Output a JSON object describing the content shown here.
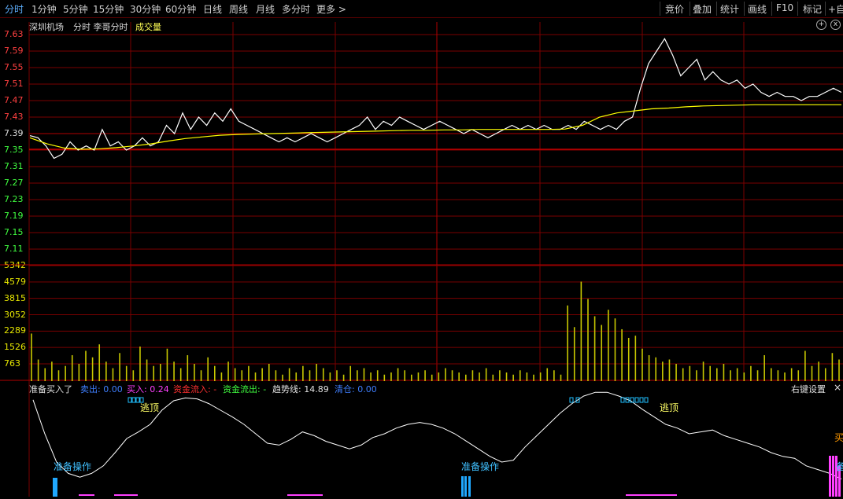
{
  "toolbar": {
    "periods": [
      "分时",
      "1分钟",
      "5分钟",
      "15分钟",
      "30分钟",
      "60分钟",
      "日线",
      "周线",
      "月线",
      "多分时",
      "更多"
    ],
    "more_glyph": ">",
    "right_buttons": [
      "竞价",
      "叠加",
      "统计",
      "画线",
      "F10",
      "标记",
      "+自"
    ]
  },
  "chart_header": {
    "stock": "深圳机场",
    "view": "分时 李哥分时",
    "indicator": "成交量",
    "controls": [
      "+",
      "x"
    ]
  },
  "indicator_bar": {
    "name": "准备买入了",
    "items": [
      {
        "label": "卖出:",
        "value": "0.00",
        "color": "#3f7fff"
      },
      {
        "label": "买入:",
        "value": "0.24",
        "color": "#ff40ff"
      },
      {
        "label": "资金流入:",
        "value": "-",
        "color": "#ff3030"
      },
      {
        "label": "资金流出:",
        "value": "-",
        "color": "#40ff40"
      },
      {
        "label": "趋势线:",
        "value": "14.89",
        "color": "#e0e0e0"
      },
      {
        "label": "清仓:",
        "value": "0.00",
        "color": "#3f7fff"
      }
    ],
    "right_settings": "右键设置",
    "close_glyph": "×"
  },
  "price_axis": [
    "7.63",
    "7.59",
    "7.55",
    "7.51",
    "7.47",
    "7.43",
    "7.39",
    "7.35",
    "7.31",
    "7.27",
    "7.23",
    "7.19",
    "7.15",
    "7.11"
  ],
  "volume_axis": [
    "5342",
    "4579",
    "3815",
    "3052",
    "2289",
    "1526",
    "763"
  ],
  "signal_labels": [
    {
      "text": "逃顶",
      "color": "#ffff66"
    },
    {
      "text": "准备操作",
      "color": "#40c0ff"
    },
    {
      "text": "准备操作",
      "color": "#40c0ff"
    },
    {
      "text": "逃顶",
      "color": "#ffff66"
    },
    {
      "text": "买",
      "color": "#ff9900"
    },
    {
      "text": "备",
      "color": "#40c0ff"
    }
  ],
  "colors": {
    "grid": "#7a0000",
    "price_line": "#ffffff",
    "avg_line": "#ffff00",
    "volume": "#c8c800",
    "up_axis": "#ff4040",
    "down_axis": "#40ff40",
    "vol_axis": "#e6e600"
  },
  "chart_data": [
    {
      "type": "line",
      "title": "",
      "series": [
        {
          "name": "",
          "values": [
            7.385,
            7.38,
            7.36,
            7.33,
            7.34,
            7.37,
            7.35,
            7.36,
            7.35,
            7.4,
            7.36,
            7.37,
            7.35,
            7.36,
            7.38,
            7.36,
            7.37,
            7.41,
            7.39,
            7.44,
            7.4,
            7.43,
            7.41,
            7.44,
            7.42,
            7.45,
            7.42,
            7.41,
            7.4,
            7.39,
            7.38,
            7.37,
            7.38,
            7.37,
            7.38,
            7.39,
            7.38,
            7.37,
            7.38,
            7.39,
            7.4,
            7.41,
            7.43,
            7.4,
            7.42,
            7.41,
            7.43,
            7.42,
            7.41,
            7.4,
            7.41,
            7.42,
            7.41,
            7.4,
            7.39,
            7.4,
            7.39,
            7.38,
            7.39,
            7.4,
            7.41,
            7.4,
            7.41,
            7.4,
            7.41,
            7.4,
            7.4,
            7.41,
            7.4,
            7.42,
            7.41,
            7.4,
            7.41,
            7.4,
            7.42,
            7.43,
            7.5,
            7.56,
            7.59,
            7.62,
            7.58,
            7.53,
            7.55,
            7.57,
            7.52,
            7.54,
            7.52,
            7.51,
            7.52,
            7.5,
            7.51,
            7.49,
            7.48,
            7.49,
            7.48,
            7.48,
            7.47,
            7.48,
            7.48,
            7.49,
            7.5,
            7.49
          ]
        }
      ],
      "avg_series": [
        7.38,
        7.365,
        7.355,
        7.352,
        7.353,
        7.356,
        7.36,
        7.365,
        7.372,
        7.378,
        7.382,
        7.386,
        7.388,
        7.389,
        7.39,
        7.391,
        7.392,
        7.393,
        7.394,
        7.395,
        7.396,
        7.397,
        7.398,
        7.398,
        7.399,
        7.399,
        7.4,
        7.4,
        7.4,
        7.4,
        7.4,
        7.401,
        7.41,
        7.43,
        7.44,
        7.445,
        7.45,
        7.452,
        7.455,
        7.457,
        7.458,
        7.459,
        7.46,
        7.46,
        7.46,
        7.46,
        7.46,
        7.46
      ],
      "ylim": [
        7.11,
        7.63
      ]
    },
    {
      "type": "bar",
      "title": "成交量",
      "values": [
        2200,
        1000,
        600,
        900,
        500,
        700,
        1200,
        800,
        1400,
        1100,
        1700,
        900,
        600,
        1300,
        700,
        500,
        1600,
        1000,
        700,
        800,
        1500,
        900,
        600,
        1200,
        800,
        500,
        1100,
        700,
        400,
        900,
        600,
        500,
        700,
        400,
        600,
        800,
        500,
        300,
        600,
        400,
        700,
        500,
        800,
        600,
        400,
        500,
        300,
        700,
        500,
        600,
        400,
        500,
        300,
        400,
        600,
        500,
        300,
        400,
        500,
        300,
        400,
        600,
        500,
        400,
        300,
        500,
        400,
        600,
        300,
        500,
        400,
        300,
        500,
        400,
        300,
        400,
        600,
        500,
        300,
        3500,
        2500,
        4600,
        3800,
        3000,
        2600,
        3300,
        2900,
        2400,
        2000,
        2100,
        1500,
        1200,
        1100,
        900,
        1000,
        800,
        600,
        700,
        500,
        900,
        700,
        600,
        800,
        500,
        600,
        400,
        700,
        500,
        1200,
        600,
        500,
        400,
        600,
        500,
        1400,
        700,
        900,
        600,
        1300,
        1000
      ],
      "ylim": [
        0,
        5342
      ]
    }
  ]
}
